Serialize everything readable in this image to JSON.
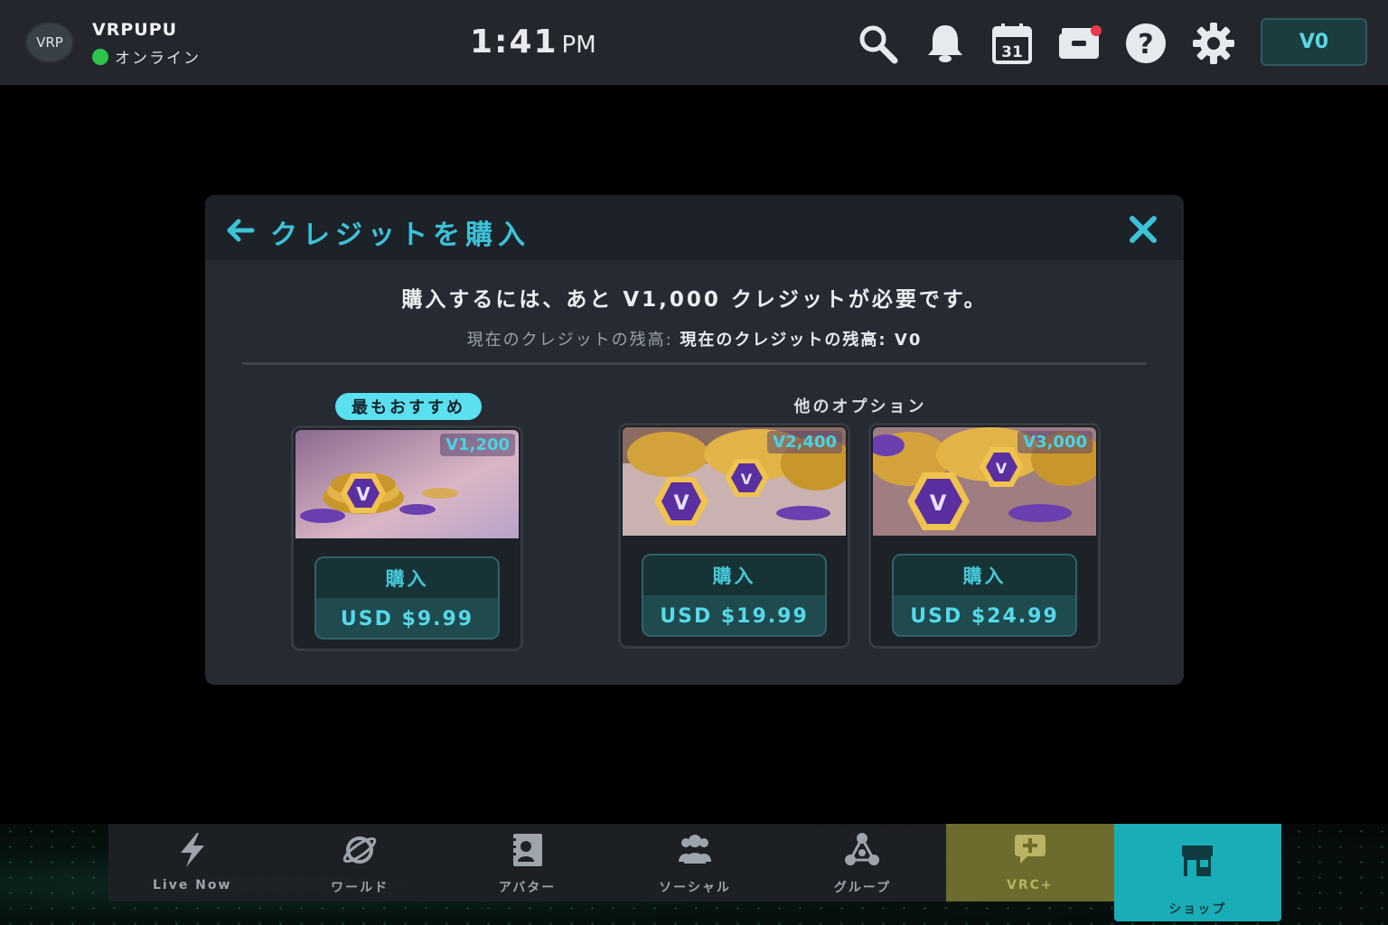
{
  "topbar": {
    "avatar_initials": "VRP",
    "username": "VRPUPU",
    "status": "オンライン",
    "time": "1:41",
    "ampm": "PM",
    "credits": "V0",
    "icons": [
      "search-icon",
      "bell-icon",
      "calendar-icon",
      "inventory-icon",
      "help-icon",
      "gear-icon"
    ],
    "calendar_day": "31"
  },
  "dialog": {
    "title": "クレジットを購入",
    "need_message": "購入するには、あと V1,000 クレジットが必要です。",
    "balance_label": "現在のクレジットの残高: ",
    "balance_value": "現在のクレジットの残高: V0",
    "recommended_badge": "最もおすすめ",
    "other_options_label": "他のオプション",
    "packages": [
      {
        "amount": "V1,200",
        "buy_label": "購入",
        "price": "USD $9.99"
      },
      {
        "amount": "V2,400",
        "buy_label": "購入",
        "price": "USD $19.99"
      },
      {
        "amount": "V3,000",
        "buy_label": "購入",
        "price": "USD $24.99"
      }
    ]
  },
  "nav": {
    "items": [
      {
        "label": "Live Now",
        "icon": "lightning-icon"
      },
      {
        "label": "ワールド",
        "icon": "planet-icon"
      },
      {
        "label": "アバター",
        "icon": "avatar-icon"
      },
      {
        "label": "ソーシャル",
        "icon": "people-icon"
      },
      {
        "label": "グループ",
        "icon": "group-icon"
      },
      {
        "label": "VRC+",
        "icon": "vrc-plus-icon"
      },
      {
        "label": "ショップ",
        "icon": "shop-icon"
      }
    ],
    "active": "ショップ"
  },
  "colors": {
    "accent": "#3cc3d8",
    "online": "#2ec44c",
    "shop_tab": "#19aeb7",
    "vrc_tab": "#6d6b2d"
  }
}
